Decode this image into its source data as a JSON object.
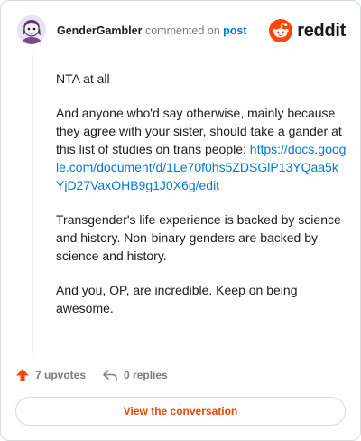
{
  "header": {
    "username": "GenderGambler",
    "commented_on": "commented on",
    "post_link": "post",
    "brand": "reddit",
    "avatar_icon": "avatar-snoo-icon",
    "brand_icon": "reddit-alien-icon"
  },
  "comment": {
    "p1": "NTA at all",
    "p2": "And anyone who'd say otherwise, mainly because they agree with your sister, should take a gander at this list of studies on trans people:",
    "link": "https://docs.google.com/document/d/1Le70f0hs5ZDSGlP13YQaa5k_YjD27VaxOHB9g1J0X6g/edit",
    "p3": "Transgender's life experience is backed by science and history. Non-binary genders are backed by science and history.",
    "p4": "And you, OP, are incredible. Keep on being awesome."
  },
  "actions": {
    "upvotes": "7 upvotes",
    "replies": "0 replies",
    "upvote_icon": "upvote-arrow-icon",
    "reply_icon": "reply-arrow-icon"
  },
  "cta": {
    "label": "View the conversation"
  },
  "colors": {
    "accent": "#ff4500",
    "link": "#0079d3",
    "cta_text": "#e24a09",
    "muted": "#7c7c7c"
  }
}
